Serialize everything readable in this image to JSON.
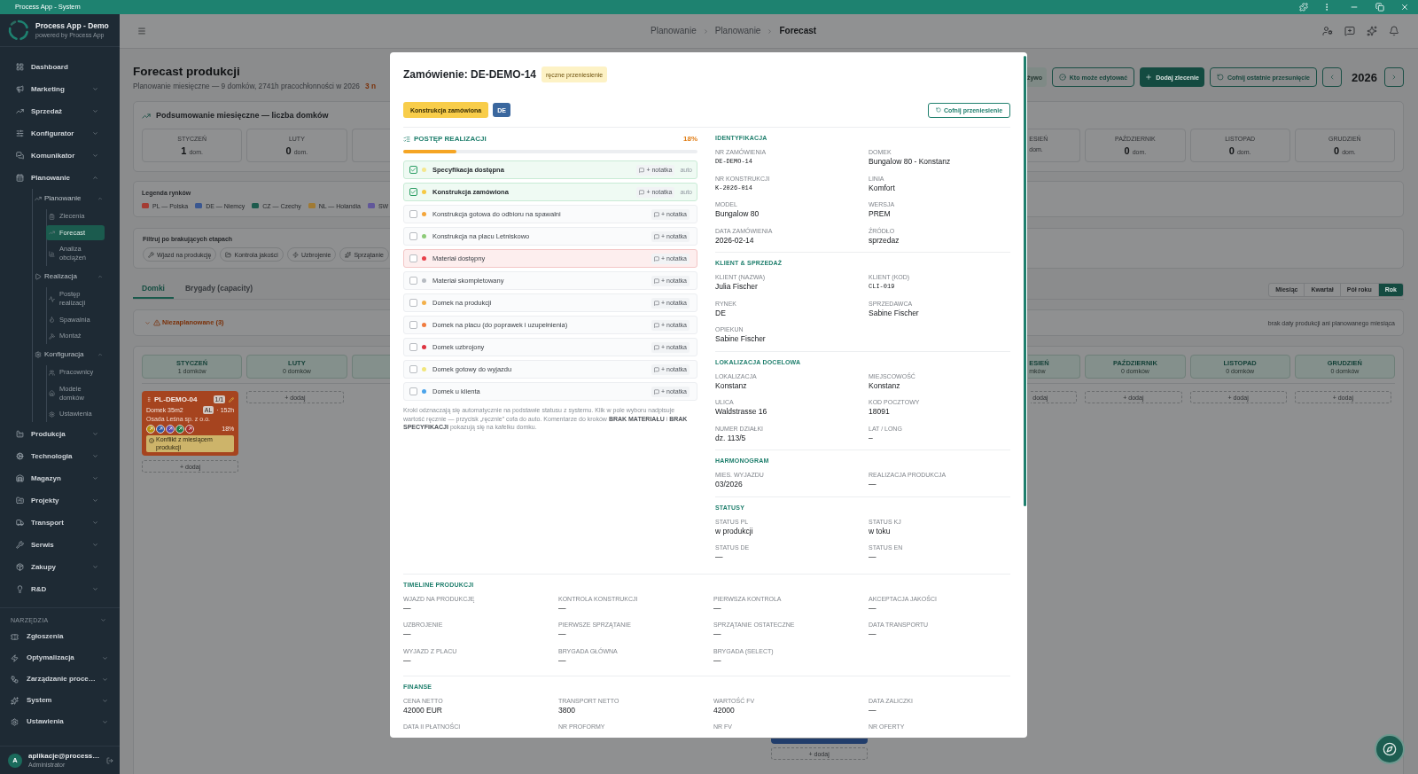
{
  "title_bar": {
    "title": "Process App - System"
  },
  "sidebar": {
    "app_name": "Process App - Demo",
    "tagline": "powered by Process App",
    "items": [
      {
        "label": "Dashboard",
        "selected": false
      },
      {
        "label": "Marketing",
        "selected": false,
        "expanded": false
      },
      {
        "label": "Sprzedaż",
        "selected": false,
        "expanded": false
      },
      {
        "label": "Konfigurator",
        "selected": false,
        "expanded": false
      },
      {
        "label": "Komunikator",
        "selected": false,
        "expanded": false
      },
      {
        "label": "Planowanie",
        "selected": false,
        "expanded": true,
        "children": [
          {
            "label": "Planowanie",
            "selected": false,
            "expanded": true,
            "children": [
              {
                "label": "Zlecenia",
                "selected": false
              },
              {
                "label": "Forecast",
                "selected": true
              },
              {
                "label": "Analiza obciążeń",
                "selected": false
              }
            ]
          },
          {
            "label": "Realizacja",
            "selected": false,
            "expanded": true,
            "children": [
              {
                "label": "Postęp realizacji",
                "selected": false
              },
              {
                "label": "Spawalnia",
                "selected": false
              },
              {
                "label": "Montaż",
                "selected": false
              }
            ]
          },
          {
            "label": "Konfiguracja",
            "selected": false,
            "expanded": true,
            "children": [
              {
                "label": "Pracownicy",
                "selected": false
              },
              {
                "label": "Modele domków",
                "selected": false
              },
              {
                "label": "Ustawienia",
                "selected": false
              }
            ]
          }
        ]
      },
      {
        "label": "Produkcja",
        "selected": false,
        "expanded": false
      },
      {
        "label": "Technologia",
        "selected": false,
        "expanded": false
      },
      {
        "label": "Magazyn",
        "selected": false,
        "expanded": false
      },
      {
        "label": "Projekty",
        "selected": false,
        "expanded": false
      },
      {
        "label": "Transport",
        "selected": false,
        "expanded": false
      },
      {
        "label": "Serwis",
        "selected": false,
        "expanded": false
      },
      {
        "label": "Zakupy",
        "selected": false,
        "expanded": false
      },
      {
        "label": "R&D",
        "selected": false,
        "expanded": false
      }
    ],
    "tools": {
      "title": "NARZĘDZIA",
      "items": [
        {
          "label": "Zgłoszenia",
          "selected": false
        },
        {
          "label": "Optymalizacja",
          "selected": false,
          "expanded": false
        },
        {
          "label": "Zarządzanie proce…",
          "selected": false,
          "expanded": false
        },
        {
          "label": "System",
          "selected": false,
          "expanded": false
        },
        {
          "label": "Ustawienia",
          "selected": false,
          "expanded": false
        }
      ]
    },
    "user": {
      "initial": "A",
      "name": "aplikacje@process…",
      "role": "Administrator"
    }
  },
  "header": {
    "breadcrumb": [
      "Planowanie",
      "Planowanie",
      "Forecast"
    ]
  },
  "page": {
    "title": "Forecast produkcji",
    "subtitle": "Planowanie miesięczne — 9 domków, 2741h pracochłonności w 2026",
    "subtitle_note": "3 n",
    "actions": [
      {
        "label": "żywo",
        "kind": "soft"
      },
      {
        "label": "Kto może edytować",
        "kind": "outline"
      },
      {
        "label": "Dodaj zlecenie",
        "kind": "primary"
      },
      {
        "label": "Cofnij ostatnie przesunięcie",
        "kind": "outline"
      }
    ],
    "year": "2026",
    "summary": {
      "title": "Podsumowanie miesięczne — liczba domków",
      "months_left": [
        {
          "label": "STYCZEŃ",
          "count": "1",
          "unit": "dom."
        },
        {
          "label": "LUTY",
          "count": "0",
          "unit": "dom."
        }
      ],
      "months_right": [
        {
          "label": "ESIEŃ",
          "unit": "dom."
        },
        {
          "label": "PAŹDZIERNIK",
          "count": "0",
          "unit": "dom."
        },
        {
          "label": "LISTOPAD",
          "count": "0",
          "unit": "dom."
        },
        {
          "label": "GRUDZIEŃ",
          "count": "0",
          "unit": "dom."
        }
      ]
    },
    "legend": {
      "title": "Legenda rynków",
      "markets": [
        {
          "label": "PL — Polska",
          "color": "#a43c33"
        },
        {
          "label": "DE — Niemcy",
          "color": "#3a5790"
        },
        {
          "label": "CZ — Czechy",
          "color": "#1d5b4d"
        },
        {
          "label": "NL — Holandia",
          "color": "#a07a33"
        },
        {
          "label": "SW",
          "color": "#61579a"
        }
      ]
    },
    "filters": {
      "title": "Filtruj po brakujących etapach",
      "chips": [
        "Wjazd na produkcję",
        "Kontrola jakości",
        "Uzbrojenie",
        "Sprzątanie"
      ]
    },
    "tabs": [
      {
        "label": "Domki",
        "selected": true
      },
      {
        "label": "Brygady (capacity)",
        "selected": false
      }
    ],
    "ranges": [
      {
        "label": "Miesiąc",
        "selected": false
      },
      {
        "label": "Kwartał",
        "selected": false
      },
      {
        "label": "Pół roku",
        "selected": false
      },
      {
        "label": "Rok",
        "selected": true
      }
    ],
    "unplanned": {
      "label": "Niezaplanowane (3)",
      "hint": "brak daty produkcji ani planowanego miesiąca"
    },
    "board": {
      "columns_left": [
        {
          "label": "STYCZEŃ",
          "count": "1 domków",
          "add_label": "+ dodaj",
          "cards": [
            {
              "code": "PL-DEMO-04",
              "count": "1/1",
              "model": "Domek 35m2",
              "tag": "AL",
              "hours": "· 152h",
              "client": "Osada Leśna sp. z o.o.",
              "percent": "18%",
              "warning": "Konflikt z miesiącem produkcji",
              "color": "#a6441f",
              "stages": [
                {
                  "color": "#b8920e"
                },
                {
                  "color": "#2f58a3"
                },
                {
                  "color": "#5e4aa9"
                },
                {
                  "color": "#1f7b47"
                },
                {
                  "color": "#a52c2c"
                }
              ]
            }
          ]
        },
        {
          "label": "LUTY",
          "count": "0 domków",
          "add_label": "+ dodaj"
        }
      ],
      "column_under_dialog": {
        "cards": [
          {
            "color": "#213d6b"
          }
        ],
        "add_label": "+ dodaj"
      },
      "columns_right": [
        {
          "label": "ESIEŃ",
          "count": "mków",
          "add_label": "dodaj"
        },
        {
          "label": "PAŹDZIERNIK",
          "count": "0 domków",
          "add_label": "+ dodaj"
        },
        {
          "label": "LISTOPAD",
          "count": "0 domków",
          "add_label": "+ dodaj"
        },
        {
          "label": "GRUDZIEŃ",
          "count": "0 domków",
          "add_label": "+ dodaj"
        }
      ]
    }
  },
  "dialog": {
    "title": "Zamówienie: DE-DEMO-14",
    "badge": "ręczne przeniesienie",
    "stage": "Konstrukcja zamówiona",
    "market": "DE",
    "undo_button": "Cofnij przeniesienie",
    "progress": {
      "title": "POSTĘP REALIZACJI",
      "percent": "18%",
      "level": 0.18,
      "steps": [
        {
          "label": "Specyfikacja dostępna",
          "checked": true,
          "alert": false,
          "color": "#f4e78f",
          "note": "+ notatka",
          "source": "auto"
        },
        {
          "label": "Konstrukcja zamówiona",
          "checked": true,
          "alert": false,
          "color": "#f6c944",
          "note": "+ notatka",
          "source": "auto"
        },
        {
          "label": "Konstrukcja gotowa do odbioru na spawalni",
          "checked": false,
          "alert": false,
          "color": "#f4a63a",
          "note": "+ notatka"
        },
        {
          "label": "Konstrukcja na placu Letniskowo",
          "checked": false,
          "alert": false,
          "color": "#8dcb78",
          "note": "+ notatka"
        },
        {
          "label": "Materiał dostępny",
          "checked": false,
          "alert": true,
          "color": "#e8404a",
          "note": "+ notatka"
        },
        {
          "label": "Materiał skompletowany",
          "checked": false,
          "alert": false,
          "color": "#b7bcc2",
          "note": "+ notatka"
        },
        {
          "label": "Domek na produkcji",
          "checked": false,
          "alert": false,
          "color": "#f3b04a",
          "note": "+ notatka"
        },
        {
          "label": "Domek na placu (do poprawek i uzupełnienia)",
          "checked": false,
          "alert": false,
          "color": "#f07b3e",
          "note": "+ notatka"
        },
        {
          "label": "Domek uzbrojony",
          "checked": false,
          "alert": false,
          "color": "#de3440",
          "note": "+ notatka"
        },
        {
          "label": "Domek gotowy do wyjazdu",
          "checked": false,
          "alert": false,
          "color": "#f1e67c",
          "note": "+ notatka"
        },
        {
          "label": "Domek u klienta",
          "checked": false,
          "alert": false,
          "color": "#4ba4ea",
          "note": "+ notatka"
        }
      ],
      "footnote": "Kroki odznaczają się automatycznie na podstawie statusu z systemu. Klik w pole wyboru nadpisuje wartość ręcznie — przycisk „ręcznie” cofa do auto. Komentarze do kroków **BRAK MATERIAŁU** i **BRAK SPECYFIKACJI** pokazują się na kafelku domku."
    },
    "sections": [
      {
        "title": "IDENTYFIKACJA",
        "fields": [
          {
            "label": "NR ZAMÓWIENIA",
            "value": "DE-DEMO-14",
            "kind": "code"
          },
          {
            "label": "DOMEK",
            "value": "Bungalow 80 - Konstanz",
            "kind": "text"
          },
          {
            "label": "NR KONSTRUKCJI",
            "value": "K-2026-014",
            "kind": "code"
          },
          {
            "label": "LINIA",
            "value": "Komfort",
            "kind": "text"
          },
          {
            "label": "MODEL",
            "value": "Bungalow 80",
            "kind": "text"
          },
          {
            "label": "WERSJA",
            "value": "PREM",
            "kind": "text"
          },
          {
            "label": "DATA ZAMÓWIENIA",
            "value": "2026-02-14",
            "kind": "text"
          },
          {
            "label": "ŹRÓDŁO",
            "value": "sprzedaz",
            "kind": "text"
          }
        ]
      },
      {
        "title": "KLIENT & SPRZEDAŻ",
        "fields": [
          {
            "label": "KLIENT (NAZWA)",
            "value": "Julia Fischer",
            "kind": "text"
          },
          {
            "label": "KLIENT (KOD)",
            "value": "CLI-019",
            "kind": "code"
          },
          {
            "label": "RYNEK",
            "value": "DE",
            "kind": "text"
          },
          {
            "label": "SPRZEDAWCA",
            "value": "Sabine Fischer",
            "kind": "text"
          },
          {
            "label": "OPIEKUN",
            "value": "Sabine Fischer",
            "kind": "text"
          }
        ]
      },
      {
        "title": "LOKALIZACJA DOCELOWA",
        "fields": [
          {
            "label": "LOKALIZACJA",
            "value": "Konstanz",
            "kind": "text"
          },
          {
            "label": "MIEJSCOWOŚĆ",
            "value": "Konstanz",
            "kind": "text"
          },
          {
            "label": "ULICA",
            "value": "Waldstrasse 16",
            "kind": "text"
          },
          {
            "label": "KOD POCZTOWY",
            "value": "18091",
            "kind": "text"
          },
          {
            "label": "NUMER DZIAŁKI",
            "value": "dz. 113/5",
            "kind": "text"
          },
          {
            "label": "LAT / LONG",
            "value": "–",
            "kind": "text"
          }
        ]
      },
      {
        "title": "HARMONOGRAM",
        "fields": [
          {
            "label": "MIES. WYJAZDU",
            "value": "03/2026",
            "kind": "text"
          },
          {
            "label": "REALIZACJA PRODUKCJA",
            "value": "—",
            "kind": "text"
          }
        ]
      },
      {
        "title": "STATUSY",
        "fields": [
          {
            "label": "STATUS PL",
            "value": "w produkcji",
            "kind": "text"
          },
          {
            "label": "STATUS KJ",
            "value": "w toku",
            "kind": "text"
          },
          {
            "label": "STATUS DE",
            "value": "—",
            "kind": "text"
          },
          {
            "label": "STATUS EN",
            "value": "—",
            "kind": "text"
          }
        ]
      }
    ],
    "wide_sections": [
      {
        "title": "TIMELINE PRODUKCJI",
        "fields": [
          {
            "label": "WJAZD NA PRODUKCJĘ",
            "value": "—",
            "kind": "text"
          },
          {
            "label": "KONTROLA KONSTRUKCJI",
            "value": "—",
            "kind": "text"
          },
          {
            "label": "PIERWSZA KONTROLA",
            "value": "—",
            "kind": "text"
          },
          {
            "label": "AKCEPTACJA JAKOŚCI",
            "value": "—",
            "kind": "text"
          },
          {
            "label": "UZBROJENIE",
            "value": "—",
            "kind": "text"
          },
          {
            "label": "PIERWSZE SPRZĄTANIE",
            "value": "—",
            "kind": "text"
          },
          {
            "label": "SPRZĄTANIE OSTATECZNE",
            "value": "—",
            "kind": "text"
          },
          {
            "label": "DATA TRANSPORTU",
            "value": "—",
            "kind": "text"
          },
          {
            "label": "WYJAZD Z PLACU",
            "value": "—",
            "kind": "text"
          },
          {
            "label": "BRYGADA GŁÓWNA",
            "value": "—",
            "kind": "text"
          },
          {
            "label": "BRYGADA (SELECT)",
            "value": "—",
            "kind": "text"
          }
        ]
      },
      {
        "title": "FINANSE",
        "fields": [
          {
            "label": "CENA NETTO",
            "value": "42000 EUR",
            "kind": "text"
          },
          {
            "label": "TRANSPORT NETTO",
            "value": "3800",
            "kind": "text"
          },
          {
            "label": "WARTOŚĆ FV",
            "value": "42000",
            "kind": "text"
          },
          {
            "label": "DATA ZALICZKI",
            "value": "—",
            "kind": "text"
          },
          {
            "label": "DATA II PŁATNOŚCI"
          },
          {
            "label": "NR PROFORMY"
          },
          {
            "label": "NR FV"
          },
          {
            "label": "NR OFERTY"
          }
        ]
      }
    ]
  }
}
